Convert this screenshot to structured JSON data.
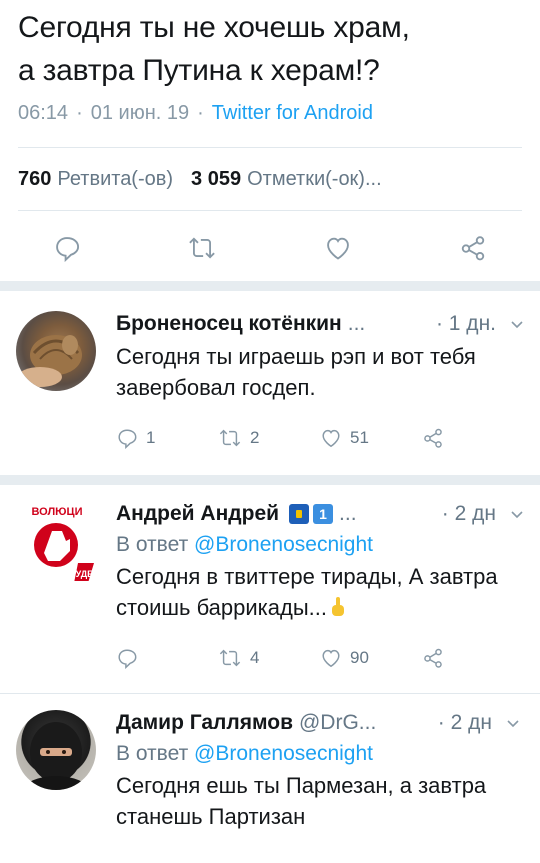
{
  "main_tweet": {
    "line1": "Сегодня ты не хочешь храм,",
    "line2": "а завтра Путина к херам!?",
    "time": "06:14",
    "dot1": "·",
    "date": "01 июн. 19",
    "dot2": "·",
    "source": "Twitter for Android",
    "retweets_count": "760",
    "retweets_label": "Ретвита(-ов)",
    "likes_count": "3 059",
    "likes_label": "Отметки(-ок)..."
  },
  "replies": [
    {
      "name": "Броненосец котёнкин",
      "handle": "...",
      "time": "· 1 дн.",
      "text": "Сегодня ты играешь рэп и вот тебя завербовал госдеп.",
      "reply_count": "1",
      "retweet_count": "2",
      "like_count": "51"
    },
    {
      "name": "Андрей Андрей",
      "handle": "...",
      "time": "· 2 дн",
      "reply_prefix": "В ответ",
      "reply_to": "@Bronenosecnight",
      "text": "Сегодня в твиттере тирады, А завтра стоишь баррикады...",
      "reply_count": "",
      "retweet_count": "4",
      "like_count": "90",
      "avatar_text_top": "ВОЛЮЦИ",
      "avatar_text_bottom": "БУДЕТ"
    },
    {
      "name": "Дамир Галлямов",
      "handle": "@DrG...",
      "time": "· 2 дн",
      "reply_prefix": "В ответ",
      "reply_to": "@Bronenosecnight",
      "text": "Сегодня ешь ты Пармезан, а завтра станешь Партизан"
    }
  ],
  "colors": {
    "accent": "#1da1f2",
    "secondary_text": "#657786",
    "icon_gray": "#8899a6"
  }
}
